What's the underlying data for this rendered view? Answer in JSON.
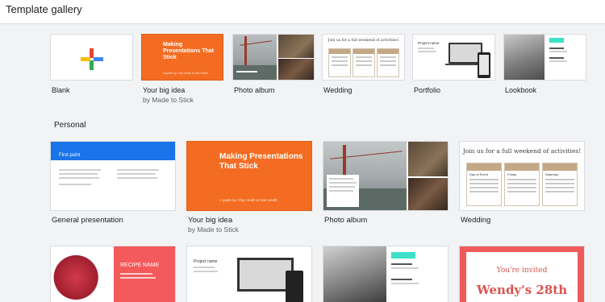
{
  "header": {
    "title": "Template gallery"
  },
  "row1": [
    {
      "id": "blank",
      "label": "Blank"
    },
    {
      "id": "big_idea",
      "label": "Your big idea",
      "sub": "by Made to Stick",
      "thumb_title": "Making Presentations That Stick",
      "thumb_sub": "A guide by Chip Heath & Dan Heath"
    },
    {
      "id": "photo",
      "label": "Photo album"
    },
    {
      "id": "wedding",
      "label": "Wedding",
      "thumb_title": "Join us for a full weekend of activities!"
    },
    {
      "id": "portfolio",
      "label": "Portfolio",
      "thumb_title": "Project name"
    },
    {
      "id": "lookbook",
      "label": "Lookbook"
    }
  ],
  "section_personal": "Personal",
  "row2": [
    {
      "id": "general",
      "label": "General presentation",
      "thumb_title": "First point"
    },
    {
      "id": "big_idea2",
      "label": "Your big idea",
      "sub": "by Made to Stick",
      "thumb_title": "Making Presentations That Stick",
      "thumb_sub": "A guide by Chip Heath & Dan Heath"
    },
    {
      "id": "photo2",
      "label": "Photo album"
    },
    {
      "id": "wedding2",
      "label": "Wedding",
      "thumb_title": "Join us for a full weekend of activities!",
      "cols": [
        "Day of Event",
        "Friday",
        "Saturday"
      ]
    }
  ],
  "row3": [
    {
      "id": "recipe",
      "thumb_title": "RECIPE NAME"
    },
    {
      "id": "portfolio2",
      "thumb_title": "Project name"
    },
    {
      "id": "lookbook2"
    },
    {
      "id": "invite",
      "thumb_title": "You're invited",
      "thumb_sub": "Wendy's 28th"
    }
  ],
  "colors": {
    "orange": "#f36c22",
    "blue": "#1a73e8",
    "recipe_red": "#f4595b",
    "invite_red": "#ef5b5b",
    "wedding_tan": "#c4a886"
  }
}
